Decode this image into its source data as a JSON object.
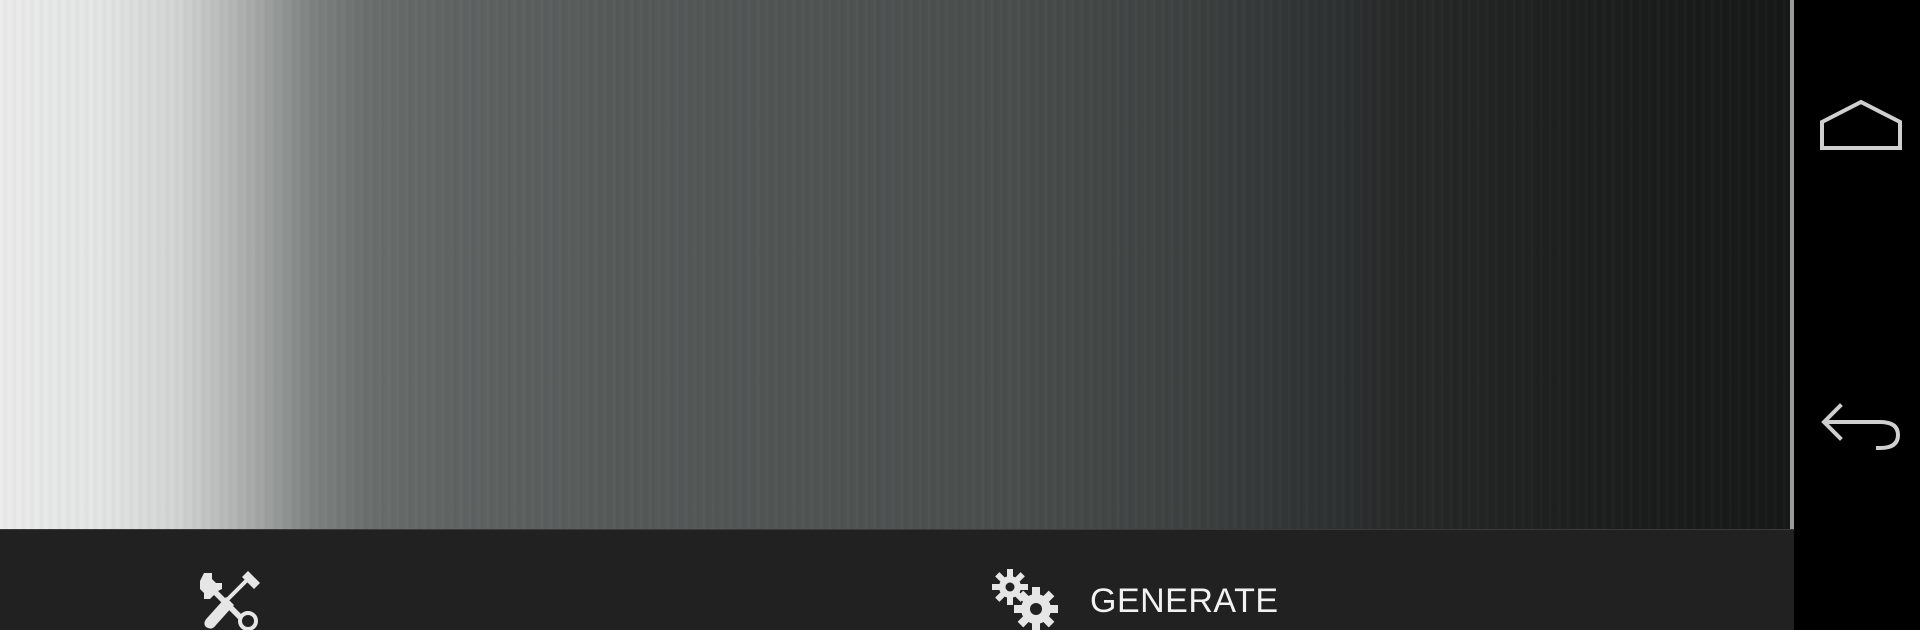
{
  "app": {
    "preview_area": {
      "content": "gradient-texture-preview",
      "gradient_from": "#ececec",
      "gradient_to": "#161717"
    },
    "action_bar": {
      "background": "#212121",
      "settings_icon": "tools-icon",
      "generate_icon": "gears-icon",
      "generate_label": "GENERATE"
    }
  },
  "system_nav": {
    "home_icon": "home-icon",
    "back_icon": "back-arrow-icon",
    "icon_color": "#cfcfcf"
  }
}
